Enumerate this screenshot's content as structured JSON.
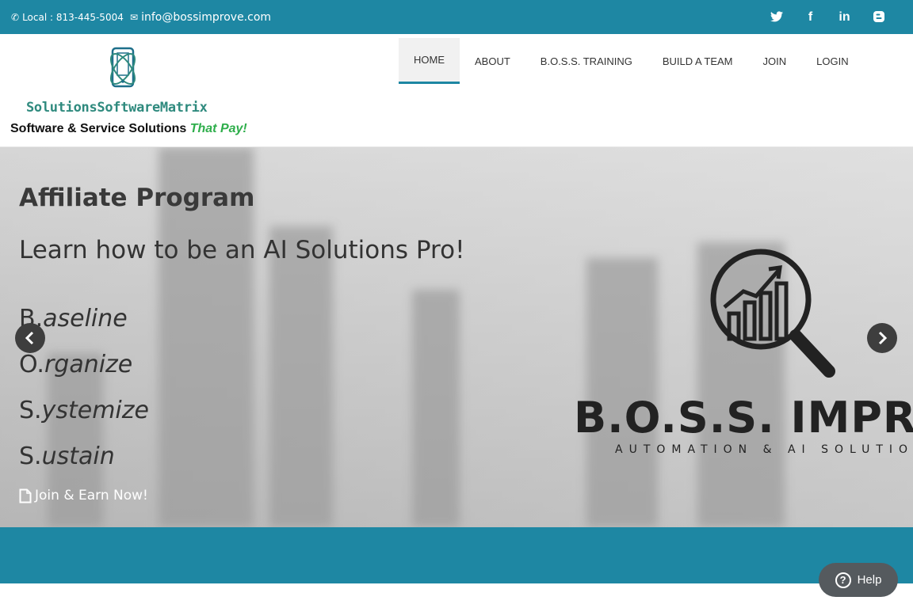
{
  "topbar": {
    "phone": "Local : 813-445-5004",
    "email": "info@bossimprove.com",
    "social": [
      "twitter-icon",
      "facebook-icon",
      "linkedin-icon",
      "blogger-icon"
    ]
  },
  "header": {
    "logo_text": "SolutionsSoftwareMatrix",
    "tagline_main": "Software & Service Solutions ",
    "tagline_highlight": "That Pay!",
    "nav": [
      {
        "label": "HOME",
        "active": true
      },
      {
        "label": "ABOUT"
      },
      {
        "label": "B.O.S.S. TRAINING"
      },
      {
        "label": "BUILD A TEAM"
      },
      {
        "label": "JOIN"
      },
      {
        "label": "LOGIN"
      }
    ]
  },
  "hero": {
    "title": "Affiliate Program",
    "subtitle": "Learn how to be an AI Solutions Pro!",
    "boss": [
      {
        "initial": "B.",
        "word": "aseline"
      },
      {
        "initial": "O.",
        "word": "rganize"
      },
      {
        "initial": "S.",
        "word": "ystemize"
      },
      {
        "initial": "S.",
        "word": "ustain"
      }
    ],
    "cta": "Join & Earn Now!",
    "brand_word": "B.O.S.S. IMPROVE",
    "brand_sub": "AUTOMATION & AI SOLUTIONS"
  },
  "help": {
    "label": "Help"
  },
  "colors": {
    "brand": "#1e87a3",
    "accent_green": "#2eae4b"
  }
}
